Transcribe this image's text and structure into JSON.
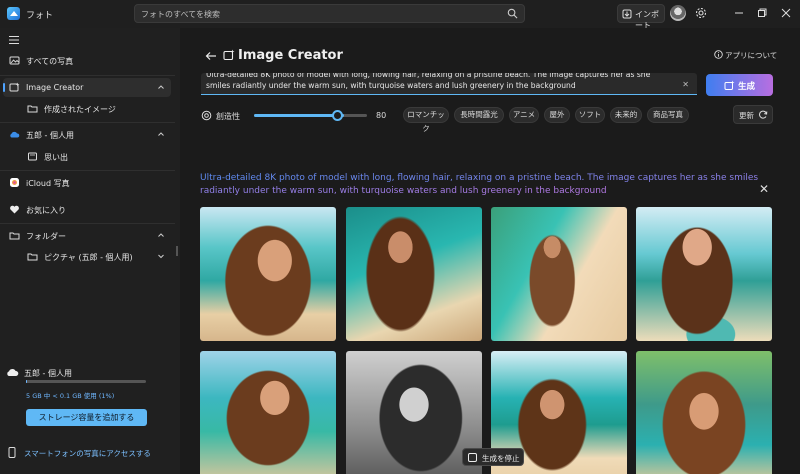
{
  "app": {
    "title": "フォト"
  },
  "search": {
    "placeholder": "フォトのすべてを検索"
  },
  "titlebar": {
    "import_label": "インポート"
  },
  "sidebar": {
    "items": [
      {
        "label": "すべての写真"
      },
      {
        "label": "Image Creator"
      },
      {
        "label": "作成されたイメージ"
      },
      {
        "label": "五郎 - 個人用"
      },
      {
        "label": "思い出"
      },
      {
        "label": "iCloud 写真"
      },
      {
        "label": "お気に入り"
      },
      {
        "label": "フォルダー"
      },
      {
        "label": "ピクチャ (五郎 - 個人用)"
      }
    ]
  },
  "storage": {
    "title": "五郎 - 個人用",
    "usage_text": "5 GB 中 < 0.1 GB 使用 (1%)",
    "usage_fraction": 0.01,
    "add_button": "ストレージ容量を追加する",
    "phone_link": "スマートフォンの写真にアクセスする"
  },
  "main": {
    "title": "Image Creator",
    "about_label": "アプリについて",
    "prompt": "Ultra-detailed 8K photo of model with long, flowing hair, relaxing on a pristine beach. The image captures her as she smiles radiantly under the warm sun, with turquoise waters and lush greenery in the background",
    "generate_label": "生成",
    "creativity_label": "創造性",
    "creativity_value": "80",
    "creativity_fraction": 0.8,
    "styles": [
      "ロマンチック",
      "長時間露光",
      "アニメ",
      "屋外",
      "ソフト",
      "未来的",
      "商品写真"
    ],
    "refresh_label": "更新",
    "result_prompt": "Ultra-detailed 8K photo of model with long, flowing hair, relaxing on a pristine beach. The image captures her as she smiles radiantly under the warm sun, with turquoise waters and lush greenery in the background",
    "stop_label": "生成を停止"
  },
  "colors": {
    "accent": "#5fb8f5",
    "gradient_start": "#3f7ef0",
    "gradient_end": "#b86ee0"
  }
}
